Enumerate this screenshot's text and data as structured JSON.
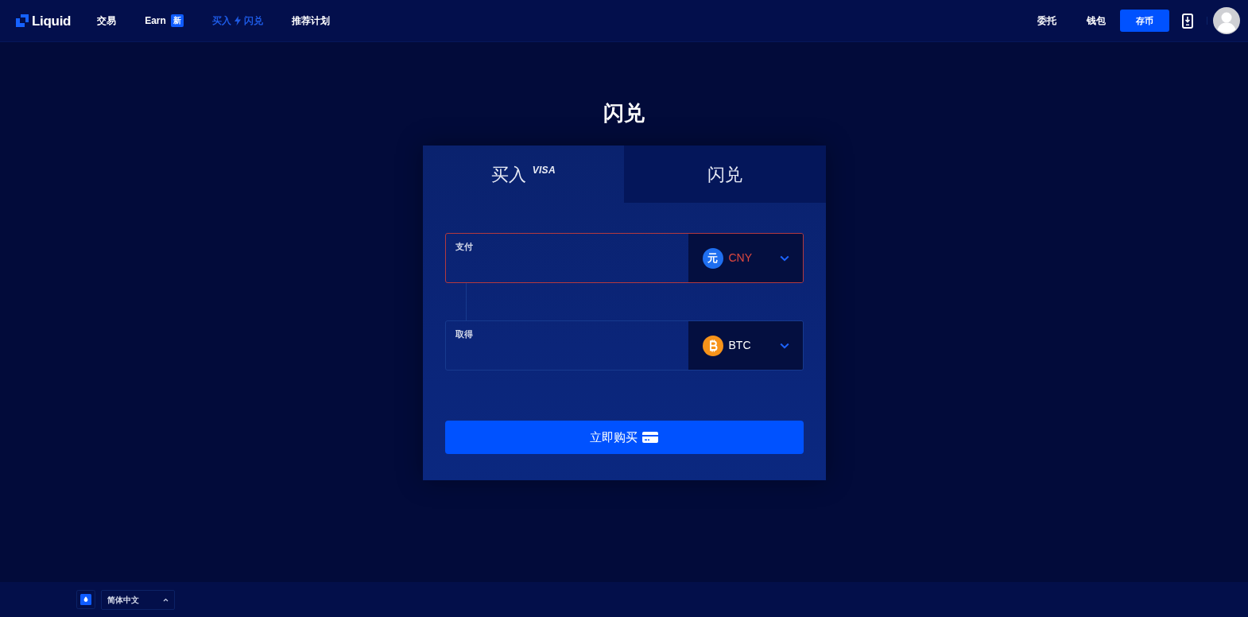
{
  "navbar": {
    "logo": "Liquid",
    "items": [
      {
        "label": "交易",
        "selected": false
      },
      {
        "label": "Earn",
        "badge": "新",
        "selected": false
      },
      {
        "label": "买入",
        "label_2": "闪兑",
        "selected": true
      },
      {
        "label": "推荐计划",
        "selected": false
      }
    ],
    "right_items": [
      {
        "label": "委托",
        "kind": "link"
      },
      {
        "label": "钱包",
        "kind": "link"
      },
      {
        "label": "存币",
        "kind": "button"
      }
    ]
  },
  "title": "闪兑",
  "tabs": [
    {
      "label": "买入",
      "badge": "VISA",
      "selected": true
    },
    {
      "label": "闪兑",
      "selected": false
    }
  ],
  "fields": [
    {
      "label": "支付",
      "kind": "fiat",
      "symbol": "元",
      "currency": "CNY",
      "invalid": true
    },
    {
      "label": "取得",
      "kind": "crypto",
      "currency": "BTC",
      "invalid": false
    }
  ],
  "submit_button": "立即购买",
  "footer": {
    "language": "简体中文"
  }
}
